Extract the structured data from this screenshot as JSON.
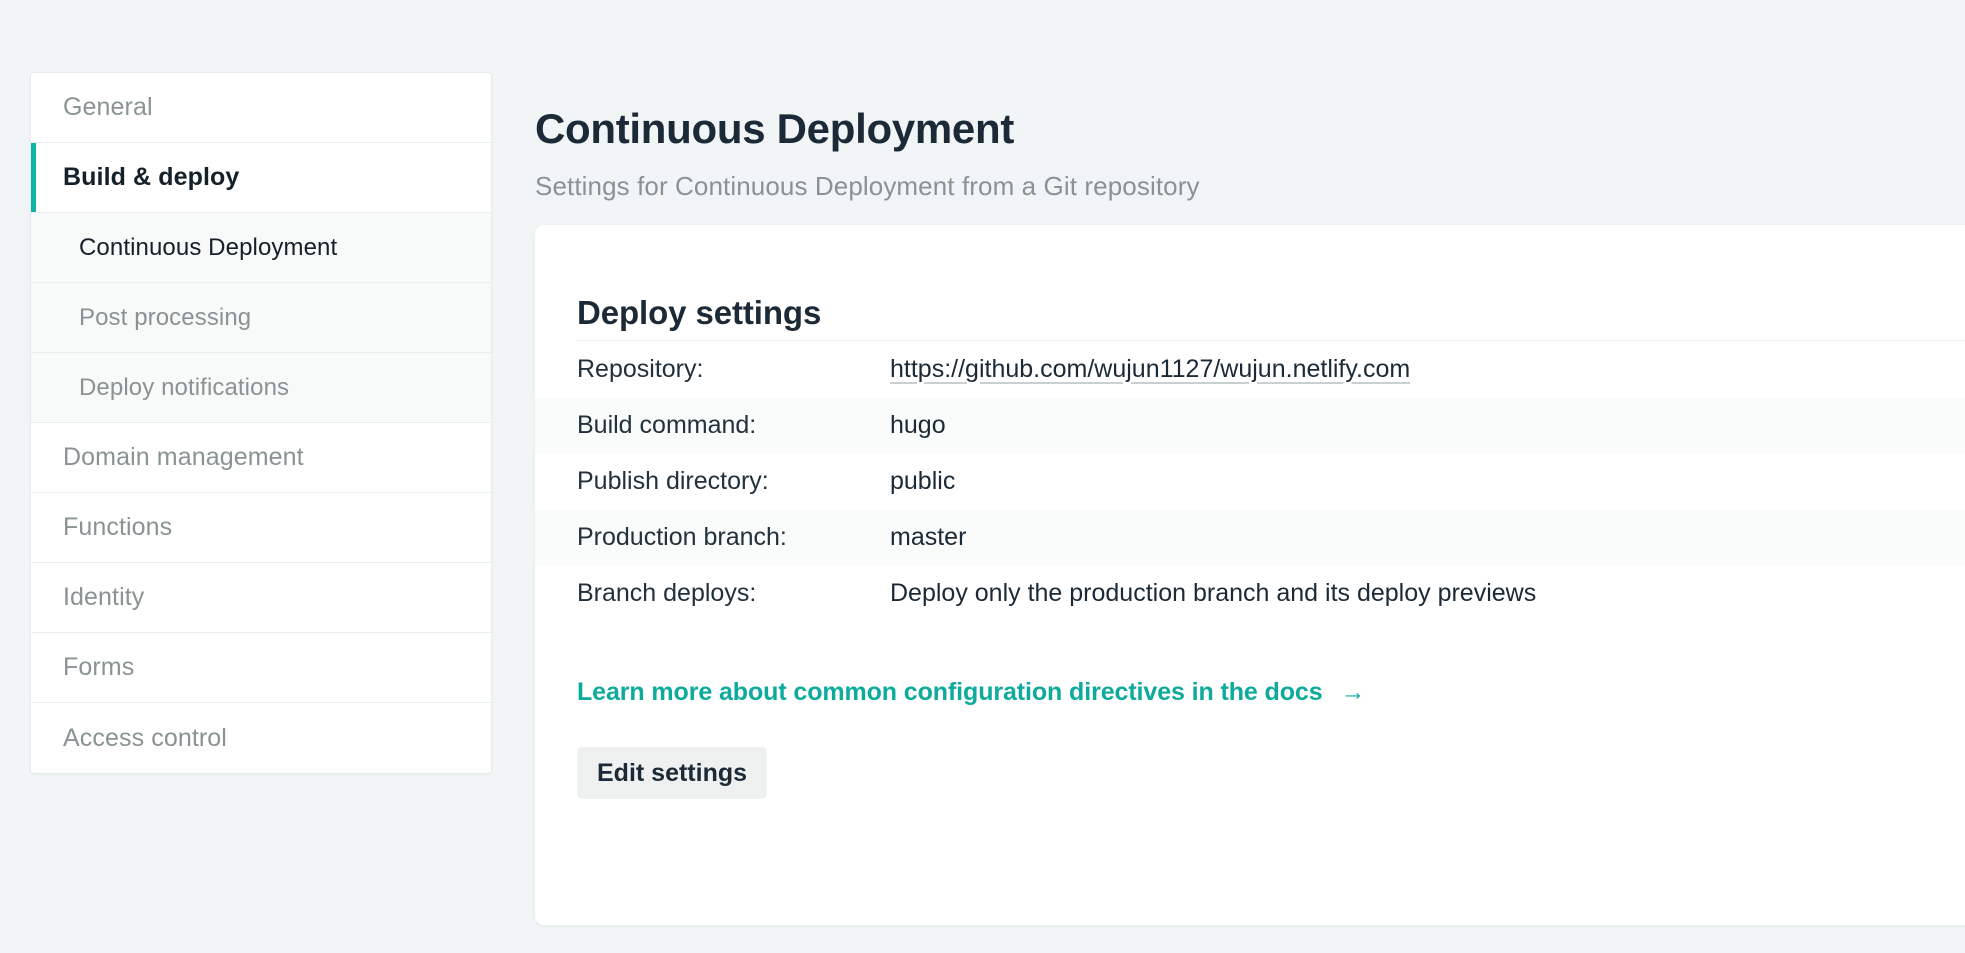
{
  "sidebar": {
    "items": [
      {
        "label": "General",
        "level": "top",
        "state": "normal"
      },
      {
        "label": "Build & deploy",
        "level": "top",
        "state": "active"
      },
      {
        "label": "Continuous Deployment",
        "level": "sub",
        "state": "current"
      },
      {
        "label": "Post processing",
        "level": "sub",
        "state": "normal"
      },
      {
        "label": "Deploy notifications",
        "level": "sub",
        "state": "normal"
      },
      {
        "label": "Domain management",
        "level": "top",
        "state": "normal"
      },
      {
        "label": "Functions",
        "level": "top",
        "state": "normal"
      },
      {
        "label": "Identity",
        "level": "top",
        "state": "normal"
      },
      {
        "label": "Forms",
        "level": "top",
        "state": "normal"
      },
      {
        "label": "Access control",
        "level": "top",
        "state": "normal"
      }
    ]
  },
  "header": {
    "title": "Continuous Deployment",
    "subtitle": "Settings for Continuous Deployment from a Git repository"
  },
  "card": {
    "title": "Deploy settings",
    "rows": [
      {
        "label": "Repository:",
        "value": "https://github.com/wujun1127/wujun.netlify.com",
        "is_link": true
      },
      {
        "label": "Build command:",
        "value": "hugo",
        "is_link": false
      },
      {
        "label": "Publish directory:",
        "value": "public",
        "is_link": false
      },
      {
        "label": "Production branch:",
        "value": "master",
        "is_link": false
      },
      {
        "label": "Branch deploys:",
        "value": "Deploy only the production branch and its deploy previews",
        "is_link": false
      }
    ],
    "docs_link": {
      "text": "Learn more about common configuration directives in the docs",
      "arrow": "→"
    },
    "edit_button": "Edit settings"
  },
  "colors": {
    "accent": "#0eb4a4",
    "link": "#0eab9c",
    "page_background": "#f1f5f5",
    "card_background": "#ffffff",
    "muted_text": "#8a9394",
    "primary_text": "#1b2a36"
  }
}
